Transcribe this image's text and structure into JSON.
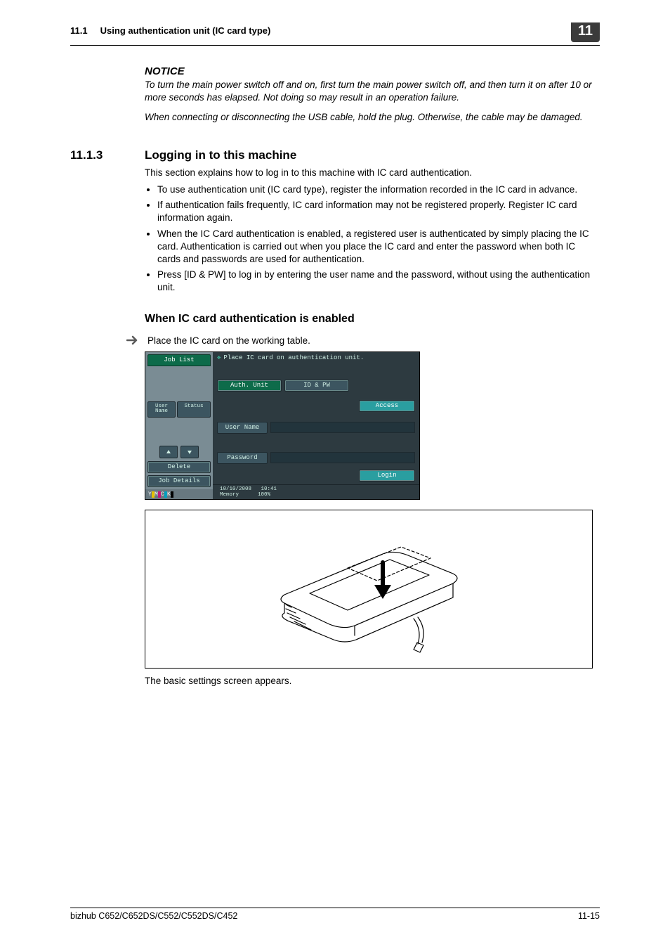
{
  "header": {
    "section_ref": "11.1",
    "section_title": "Using authentication unit (IC card type)",
    "chapter": "11"
  },
  "notice": {
    "heading": "NOTICE",
    "p1": "To turn the main power switch off and on, first turn the main power switch off, and then turn it on after 10 or more seconds has elapsed. Not doing so may result in an operation failure.",
    "p2": "When connecting or disconnecting the USB cable, hold the plug. Otherwise, the cable may be damaged."
  },
  "section": {
    "number": "11.1.3",
    "title": "Logging in to this machine",
    "intro": "This section explains how to log in to this machine with IC card authentication.",
    "bullets": [
      "To use authentication unit (IC card type), register the information recorded in the IC card in advance.",
      "If authentication fails frequently, IC card information may not be registered properly. Register IC card information again.",
      "When the IC Card authentication is enabled, a registered user is authenticated by simply placing the IC card. Authentication is carried out when you place the IC card and enter the password when both IC cards and passwords are used for authentication.",
      "Press [ID & PW] to log in by entering the user name and the password, without using the authentication unit."
    ]
  },
  "subhead": "When IC card authentication is enabled",
  "step1": "Place the IC card on the working table.",
  "panel": {
    "job_list": "Job List",
    "prompt": "Place IC card on authentication unit.",
    "auth_unit": "Auth. Unit",
    "id_pw": "ID & PW",
    "access": "Access",
    "user_pane_hdr": "User\nName",
    "status_hdr": "Status",
    "user_name": "User Name",
    "password": "Password",
    "delete": "Delete",
    "job_details": "Job Details",
    "login": "Login",
    "date": "10/10/2008",
    "time": "10:41",
    "memory": "Memory",
    "mempct": "100%",
    "toner": [
      "Y",
      "M",
      "C",
      "K"
    ]
  },
  "result": "The basic settings screen appears.",
  "footer": {
    "model": "bizhub C652/C652DS/C552/C552DS/C452",
    "page": "11-15"
  }
}
